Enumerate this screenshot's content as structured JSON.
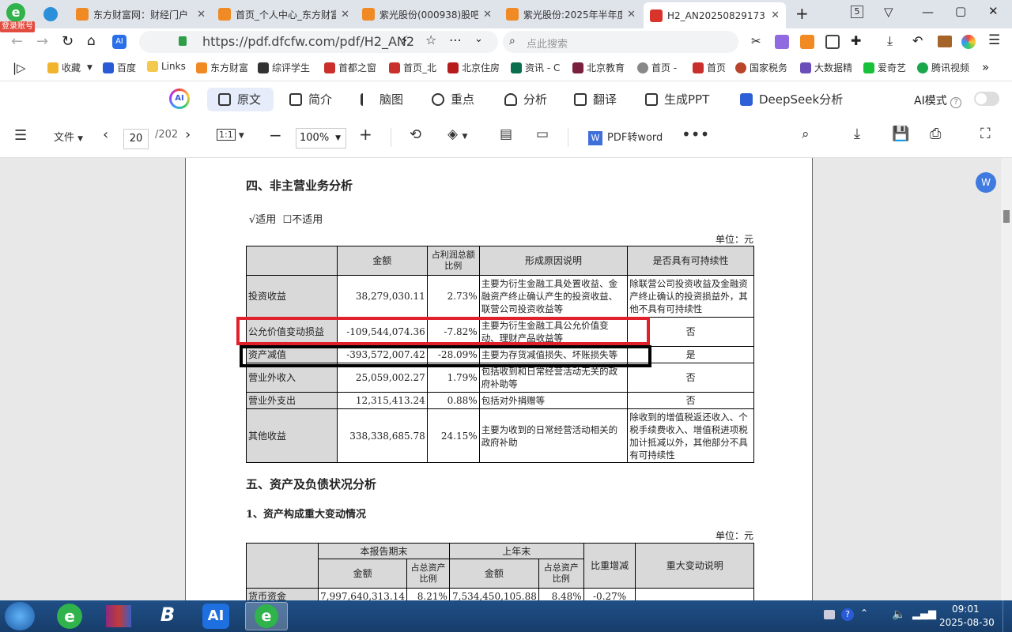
{
  "tabs": [
    {
      "title": "东方财富网：财经门户"
    },
    {
      "title": "首页_个人中心_东方财富"
    },
    {
      "title": "紫光股份(000938)股吧"
    },
    {
      "title": "紫光股份:2025年半年度"
    },
    {
      "title": "H2_AN20250829173"
    }
  ],
  "login_badge": "登录账号",
  "tab_count": "5",
  "address": {
    "url": "https://pdf.dfcfw.com/pdf/H2_AN2",
    "search_placeholder": "点此搜索"
  },
  "bookmarks": [
    "收藏",
    "百度",
    "Links",
    "东方财富",
    "综评学生",
    "首都之窗",
    "首页_北",
    "北京住房",
    "资讯 - C",
    "北京教育",
    "首页 -",
    "首页",
    "国家税务",
    "大数据精",
    "爱奇艺",
    "腾讯视频"
  ],
  "ai_toolbar": {
    "items": [
      "原文",
      "简介",
      "脑图",
      "重点",
      "分析",
      "翻译",
      "生成PPT",
      "DeepSeek分析"
    ],
    "mode_label": "AI模式"
  },
  "pdf_toolbar": {
    "file": "文件",
    "page": "20",
    "total": "/202",
    "fit": "1:1",
    "zoom": "100%",
    "convert": "PDF转word"
  },
  "doc": {
    "section4_title": "四、非主营业务分析",
    "applicable": "√适用",
    "not_applicable": "☐不适用",
    "unit": "单位：元",
    "table1_headers": [
      "",
      "金额",
      "占利润总额比例",
      "形成原因说明",
      "是否具有可持续性"
    ],
    "table1_rows": [
      [
        "投资收益",
        "38,279,030.11",
        "2.73%",
        "主要为衍生金融工具处置收益、金融资产终止确认产生的投资收益、联营公司投资收益等",
        "除联营公司投资收益及金融资产终止确认的投资损益外，其他不具有可持续性"
      ],
      [
        "公允价值变动损益",
        "-109,544,074.36",
        "-7.82%",
        "主要为衍生金融工具公允价值变动、理财产品收益等",
        "否"
      ],
      [
        "资产减值",
        "-393,572,007.42",
        "-28.09%",
        "主要为存货减值损失、坏账损失等",
        "是"
      ],
      [
        "营业外收入",
        "25,059,002.27",
        "1.79%",
        "包括收到和日常经营活动无关的政府补助等",
        "否"
      ],
      [
        "营业外支出",
        "12,315,413.24",
        "0.88%",
        "包括对外捐赠等",
        "否"
      ],
      [
        "其他收益",
        "338,338,685.78",
        "24.15%",
        "主要为收到的日常经营活动相关的政府补助",
        "除收到的增值税返还收入、个税手续费收入、增值税进项税加计抵减以外，其他部分不具有可持续性"
      ]
    ],
    "section5_title": "五、资产及负债状况分析",
    "sub1_title": "1、资产构成重大变动情况",
    "unit2": "单位：元",
    "table2": {
      "period_end": "本报告期末",
      "prior_year_end": "上年末",
      "amount": "金额",
      "ratio": "占总资产比例",
      "change": "比重增减",
      "note": "重大变动说明",
      "row1": [
        "货币资金",
        "7,997,640,313.14",
        "8.21%",
        "7,534,450,105.88",
        "8.48%",
        "-0.27%"
      ]
    }
  },
  "taskbar": {
    "time": "09:01",
    "date": "2025-08-30",
    "ai_label": "AI"
  }
}
